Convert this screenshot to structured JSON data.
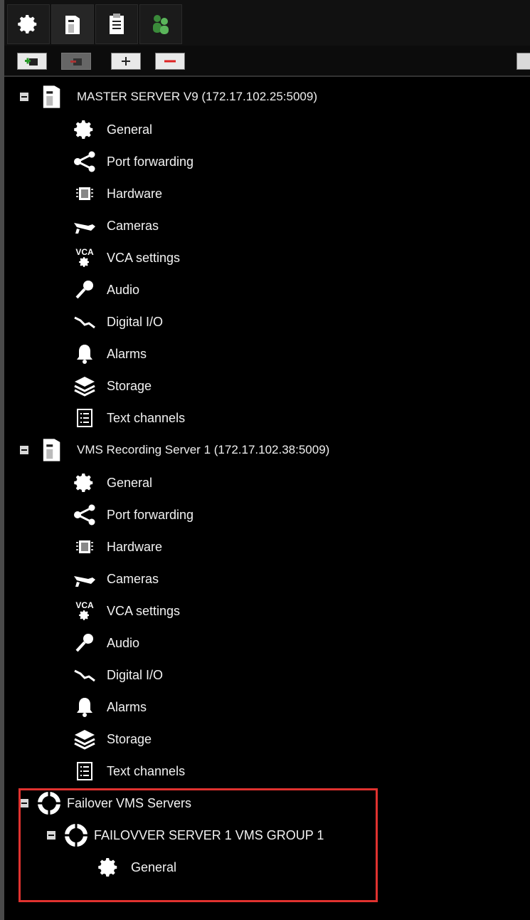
{
  "tabs": [
    {
      "icon": "gear-icon"
    },
    {
      "icon": "server-icon"
    },
    {
      "icon": "clipboard-icon"
    },
    {
      "icon": "users-icon"
    }
  ],
  "toolbar": {
    "buttons": [
      {
        "icon": "add-server-icon"
      },
      {
        "icon": "remove-server-icon"
      },
      {
        "icon": "plus-icon"
      },
      {
        "icon": "minus-icon"
      }
    ]
  },
  "tree": {
    "server1": {
      "title": "MASTER SERVER V9 (172.17.102.25:5009)",
      "items": [
        "General",
        "Port forwarding",
        "Hardware",
        "Cameras",
        "VCA settings",
        "Audio",
        "Digital I/O",
        "Alarms",
        "Storage",
        "Text channels"
      ]
    },
    "server2": {
      "title": "VMS Recording Server 1 (172.17.102.38:5009)",
      "items": [
        "General",
        "Port forwarding",
        "Hardware",
        "Cameras",
        "VCA settings",
        "Audio",
        "Digital I/O",
        "Alarms",
        "Storage",
        "Text channels"
      ]
    },
    "failover": {
      "title": "Failover VMS Servers",
      "group_title": "FAILOVVER SERVER 1 VMS GROUP 1",
      "group_items": [
        "General"
      ]
    },
    "vca_icon_text": "VCA"
  },
  "colors": {
    "background": "#000000",
    "highlight": "#e0322f"
  }
}
